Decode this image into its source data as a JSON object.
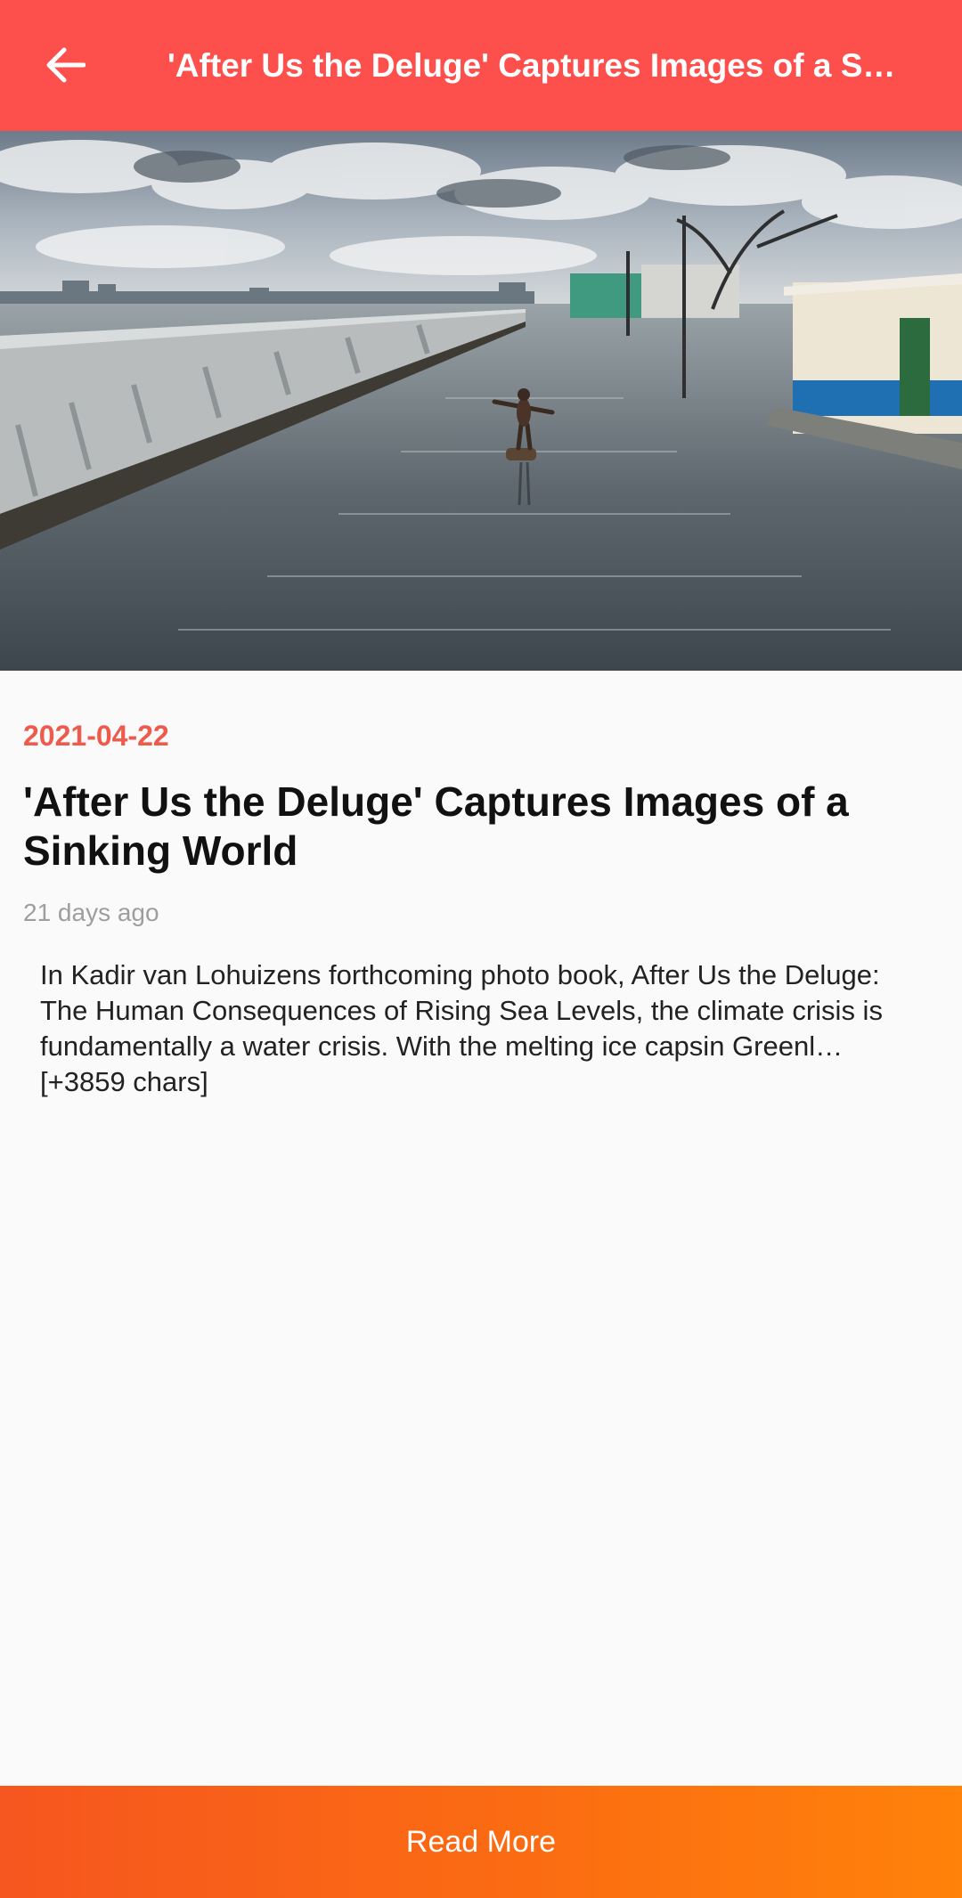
{
  "appbar": {
    "title": "'After Us the Deluge' Captures Images of a Sinking World",
    "back_icon": "arrow-left-icon"
  },
  "hero": {
    "description": "Photo of a boy balancing on a log in a flooded street beside a sea wall"
  },
  "article": {
    "date": "2021-04-22",
    "headline": "'After Us the Deluge' Captures Images of a Sinking World",
    "relative_time": "21 days ago",
    "description": "In Kadir van Lohuizens forthcoming photo book, After Us the Deluge: The Human Consequences of Rising Sea Levels, the climate crisis is fundamentally a water crisis. With the melting ice capsin Greenl… [+3859 chars]"
  },
  "footer": {
    "read_more_label": "Read More"
  },
  "colors": {
    "appbar": "#fd4f4b",
    "date": "#ee5a4c",
    "button_start": "#f6561f",
    "button_end": "#ff820a"
  }
}
